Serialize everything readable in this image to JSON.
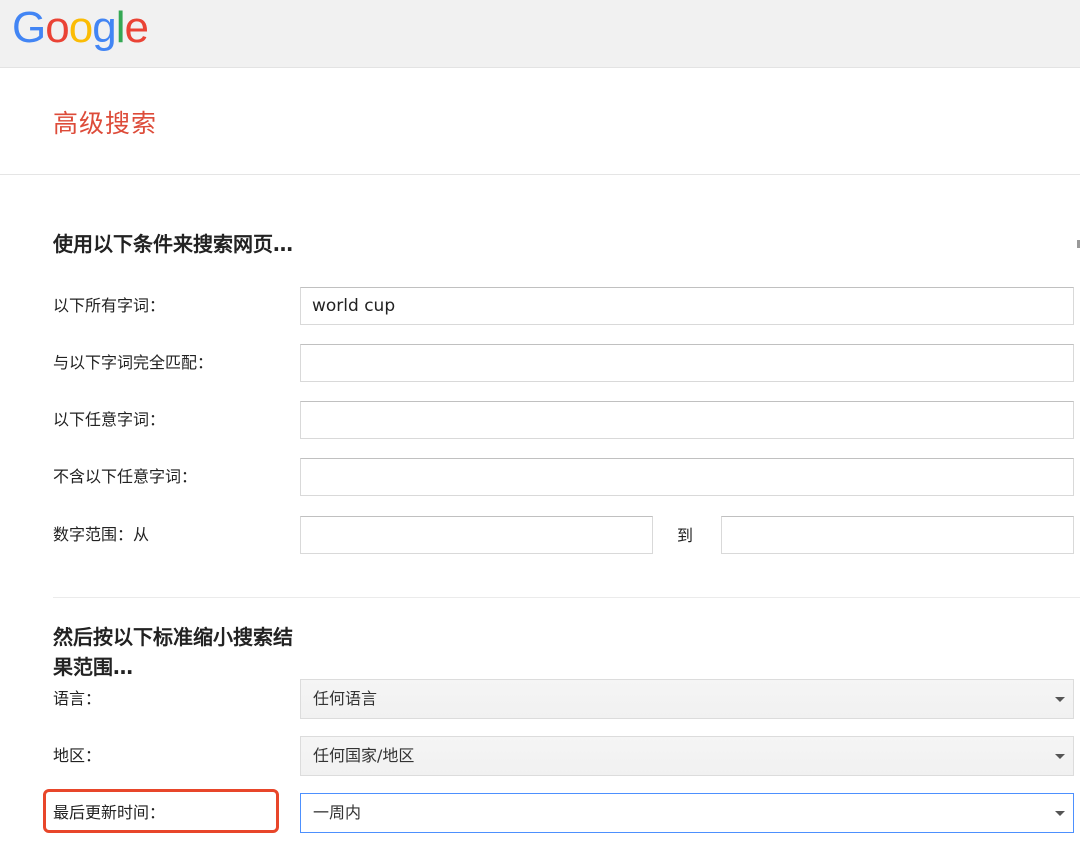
{
  "header": {
    "logo_letters": [
      {
        "ch": "G",
        "color": "#4285f4"
      },
      {
        "ch": "o",
        "color": "#ea4335"
      },
      {
        "ch": "o",
        "color": "#fbbc05"
      },
      {
        "ch": "g",
        "color": "#4285f4"
      },
      {
        "ch": "l",
        "color": "#34a853"
      },
      {
        "ch": "e",
        "color": "#ea4335"
      }
    ]
  },
  "page": {
    "title": "高级搜索",
    "title_color": "#dd4b39"
  },
  "section1": {
    "title": "使用以下条件来搜索网页…",
    "rows": {
      "all_words_label": "以下所有字词：",
      "all_words_value": "world cup",
      "exact_phrase_label": "与以下字词完全匹配：",
      "exact_phrase_value": "",
      "any_words_label": "以下任意字词：",
      "any_words_value": "",
      "none_words_label": "不含以下任意字词：",
      "none_words_value": "",
      "number_range_label": "数字范围：从",
      "number_from_value": "",
      "number_to_label": "到",
      "number_to_value": ""
    }
  },
  "section2": {
    "title": "然后按以下标准缩小搜索结果范围…",
    "rows": {
      "language_label": "语言：",
      "language_value": "任何语言",
      "region_label": "地区：",
      "region_value": "任何国家/地区",
      "last_update_label": "最后更新时间：",
      "last_update_value": "一周内"
    }
  },
  "annotation": {
    "highlight_color": "#e8462a"
  }
}
